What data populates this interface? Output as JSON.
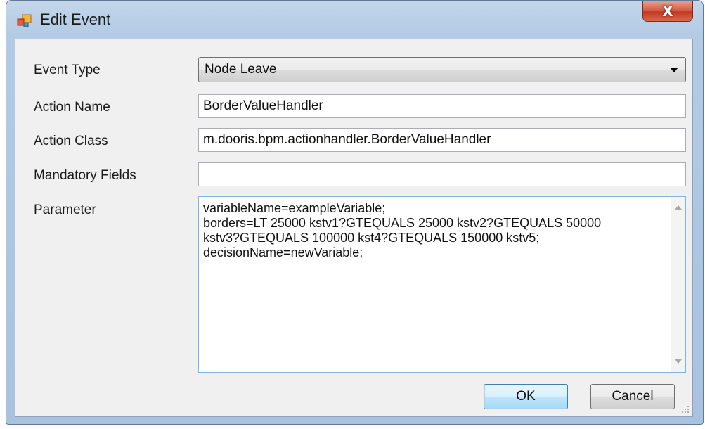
{
  "window": {
    "title": "Edit Event",
    "close_label": "X"
  },
  "form": {
    "event_type": {
      "label": "Event Type",
      "value": "Node Leave"
    },
    "action_name": {
      "label": "Action Name",
      "value": "BorderValueHandler"
    },
    "action_class": {
      "label": "Action Class",
      "value": "m.dooris.bpm.actionhandler.BorderValueHandler"
    },
    "mandatory_fields": {
      "label": "Mandatory Fields",
      "value": ""
    },
    "parameter": {
      "label": "Parameter",
      "value": "variableName=exampleVariable;\nborders=LT 25000 kstv1?GTEQUALS 25000 kstv2?GTEQUALS 50000\nkstv3?GTEQUALS 100000 kst4?GTEQUALS 150000 kstv5;\ndecisionName=newVariable;"
    }
  },
  "buttons": {
    "ok_label": "OK",
    "cancel_label": "Cancel"
  },
  "icons": {
    "app": "form-icon",
    "close": "close-icon",
    "combo": "chevron-down-icon"
  },
  "colors": {
    "title_bar": "#b3cbe4",
    "client_bg": "#f0f0f0",
    "close_button": "#c2381f",
    "focus_border": "#7eb4ea"
  }
}
